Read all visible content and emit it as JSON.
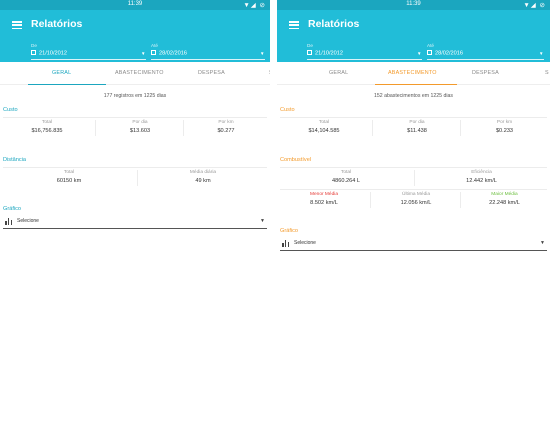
{
  "colors": {
    "primary": "#21bdd8",
    "status": "#1ba6bf",
    "accent_orange": "#f39a2b",
    "red": "#e53935",
    "green": "#6cbf3f"
  },
  "icons": {
    "menu": "hamburger-icon",
    "calendar": "calendar-icon",
    "chart": "bar-chart-icon",
    "dropdown": "triangle-down-icon"
  },
  "left": {
    "status_time": "11:39",
    "title": "Relatórios",
    "date_from": {
      "label": "De",
      "value": "21/10/2012"
    },
    "date_to": {
      "label": "Até",
      "value": "28/02/2016"
    },
    "tabs": [
      "GERAL",
      "ABASTECIMENTO",
      "DESPESA",
      "S"
    ],
    "active_tab": "GERAL",
    "summary": "177 registros em 1225 dias",
    "cost": {
      "title": "Custo",
      "items": [
        {
          "label": "Total",
          "value": "$16,756.835"
        },
        {
          "label": "Por dia",
          "value": "$13.603"
        },
        {
          "label": "Por km",
          "value": "$0.277"
        }
      ]
    },
    "distance": {
      "title": "Distância",
      "items": [
        {
          "label": "Total",
          "value": "60150 km"
        },
        {
          "label": "Média diária",
          "value": "49 km"
        }
      ]
    },
    "chart": {
      "title": "Gráfico",
      "select": "Selecione"
    }
  },
  "right": {
    "status_time": "11:39",
    "title": "Relatórios",
    "date_from": {
      "label": "De",
      "value": "21/10/2012"
    },
    "date_to": {
      "label": "Até",
      "value": "28/02/2016"
    },
    "tabs": [
      "GERAL",
      "ABASTECIMENTO",
      "DESPESA",
      "S"
    ],
    "active_tab": "ABASTECIMENTO",
    "summary": "152 abastecimentos em 1225 dias",
    "cost": {
      "title": "Custo",
      "items": [
        {
          "label": "Total",
          "value": "$14,104.585"
        },
        {
          "label": "Por dia",
          "value": "$11.438"
        },
        {
          "label": "Por km",
          "value": "$0.233"
        }
      ]
    },
    "fuel": {
      "title": "Combustível",
      "total": {
        "label": "Total",
        "value": "4860.264 L"
      },
      "efficiency": {
        "label": "Eficiência",
        "value": "12.442 km/L"
      },
      "lowest": {
        "label": "Menor Média",
        "value": "8.502 km/L"
      },
      "last": {
        "label": "Última Média",
        "value": "12.056 km/L"
      },
      "highest": {
        "label": "Maior Média",
        "value": "22.248 km/L"
      }
    },
    "chart": {
      "title": "Gráfico",
      "select": "Selecione"
    }
  }
}
